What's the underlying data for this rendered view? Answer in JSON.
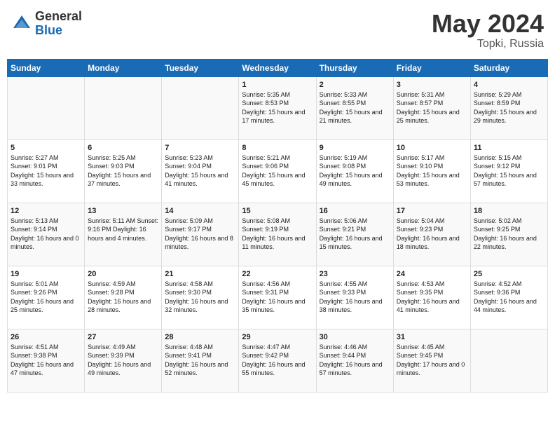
{
  "header": {
    "logo_general": "General",
    "logo_blue": "Blue",
    "title": "May 2024",
    "subtitle": "Topki, Russia"
  },
  "weekdays": [
    "Sunday",
    "Monday",
    "Tuesday",
    "Wednesday",
    "Thursday",
    "Friday",
    "Saturday"
  ],
  "weeks": [
    [
      {
        "day": "",
        "info": ""
      },
      {
        "day": "",
        "info": ""
      },
      {
        "day": "",
        "info": ""
      },
      {
        "day": "1",
        "info": "Sunrise: 5:35 AM\nSunset: 8:53 PM\nDaylight: 15 hours\nand 17 minutes."
      },
      {
        "day": "2",
        "info": "Sunrise: 5:33 AM\nSunset: 8:55 PM\nDaylight: 15 hours\nand 21 minutes."
      },
      {
        "day": "3",
        "info": "Sunrise: 5:31 AM\nSunset: 8:57 PM\nDaylight: 15 hours\nand 25 minutes."
      },
      {
        "day": "4",
        "info": "Sunrise: 5:29 AM\nSunset: 8:59 PM\nDaylight: 15 hours\nand 29 minutes."
      }
    ],
    [
      {
        "day": "5",
        "info": "Sunrise: 5:27 AM\nSunset: 9:01 PM\nDaylight: 15 hours\nand 33 minutes."
      },
      {
        "day": "6",
        "info": "Sunrise: 5:25 AM\nSunset: 9:03 PM\nDaylight: 15 hours\nand 37 minutes."
      },
      {
        "day": "7",
        "info": "Sunrise: 5:23 AM\nSunset: 9:04 PM\nDaylight: 15 hours\nand 41 minutes."
      },
      {
        "day": "8",
        "info": "Sunrise: 5:21 AM\nSunset: 9:06 PM\nDaylight: 15 hours\nand 45 minutes."
      },
      {
        "day": "9",
        "info": "Sunrise: 5:19 AM\nSunset: 9:08 PM\nDaylight: 15 hours\nand 49 minutes."
      },
      {
        "day": "10",
        "info": "Sunrise: 5:17 AM\nSunset: 9:10 PM\nDaylight: 15 hours\nand 53 minutes."
      },
      {
        "day": "11",
        "info": "Sunrise: 5:15 AM\nSunset: 9:12 PM\nDaylight: 15 hours\nand 57 minutes."
      }
    ],
    [
      {
        "day": "12",
        "info": "Sunrise: 5:13 AM\nSunset: 9:14 PM\nDaylight: 16 hours\nand 0 minutes."
      },
      {
        "day": "13",
        "info": "Sunrise: 5:11 AM\nSunset: 9:16 PM\nDaylight: 16 hours\nand 4 minutes."
      },
      {
        "day": "14",
        "info": "Sunrise: 5:09 AM\nSunset: 9:17 PM\nDaylight: 16 hours\nand 8 minutes."
      },
      {
        "day": "15",
        "info": "Sunrise: 5:08 AM\nSunset: 9:19 PM\nDaylight: 16 hours\nand 11 minutes."
      },
      {
        "day": "16",
        "info": "Sunrise: 5:06 AM\nSunset: 9:21 PM\nDaylight: 16 hours\nand 15 minutes."
      },
      {
        "day": "17",
        "info": "Sunrise: 5:04 AM\nSunset: 9:23 PM\nDaylight: 16 hours\nand 18 minutes."
      },
      {
        "day": "18",
        "info": "Sunrise: 5:02 AM\nSunset: 9:25 PM\nDaylight: 16 hours\nand 22 minutes."
      }
    ],
    [
      {
        "day": "19",
        "info": "Sunrise: 5:01 AM\nSunset: 9:26 PM\nDaylight: 16 hours\nand 25 minutes."
      },
      {
        "day": "20",
        "info": "Sunrise: 4:59 AM\nSunset: 9:28 PM\nDaylight: 16 hours\nand 28 minutes."
      },
      {
        "day": "21",
        "info": "Sunrise: 4:58 AM\nSunset: 9:30 PM\nDaylight: 16 hours\nand 32 minutes."
      },
      {
        "day": "22",
        "info": "Sunrise: 4:56 AM\nSunset: 9:31 PM\nDaylight: 16 hours\nand 35 minutes."
      },
      {
        "day": "23",
        "info": "Sunrise: 4:55 AM\nSunset: 9:33 PM\nDaylight: 16 hours\nand 38 minutes."
      },
      {
        "day": "24",
        "info": "Sunrise: 4:53 AM\nSunset: 9:35 PM\nDaylight: 16 hours\nand 41 minutes."
      },
      {
        "day": "25",
        "info": "Sunrise: 4:52 AM\nSunset: 9:36 PM\nDaylight: 16 hours\nand 44 minutes."
      }
    ],
    [
      {
        "day": "26",
        "info": "Sunrise: 4:51 AM\nSunset: 9:38 PM\nDaylight: 16 hours\nand 47 minutes."
      },
      {
        "day": "27",
        "info": "Sunrise: 4:49 AM\nSunset: 9:39 PM\nDaylight: 16 hours\nand 49 minutes."
      },
      {
        "day": "28",
        "info": "Sunrise: 4:48 AM\nSunset: 9:41 PM\nDaylight: 16 hours\nand 52 minutes."
      },
      {
        "day": "29",
        "info": "Sunrise: 4:47 AM\nSunset: 9:42 PM\nDaylight: 16 hours\nand 55 minutes."
      },
      {
        "day": "30",
        "info": "Sunrise: 4:46 AM\nSunset: 9:44 PM\nDaylight: 16 hours\nand 57 minutes."
      },
      {
        "day": "31",
        "info": "Sunrise: 4:45 AM\nSunset: 9:45 PM\nDaylight: 17 hours\nand 0 minutes."
      },
      {
        "day": "",
        "info": ""
      }
    ]
  ]
}
